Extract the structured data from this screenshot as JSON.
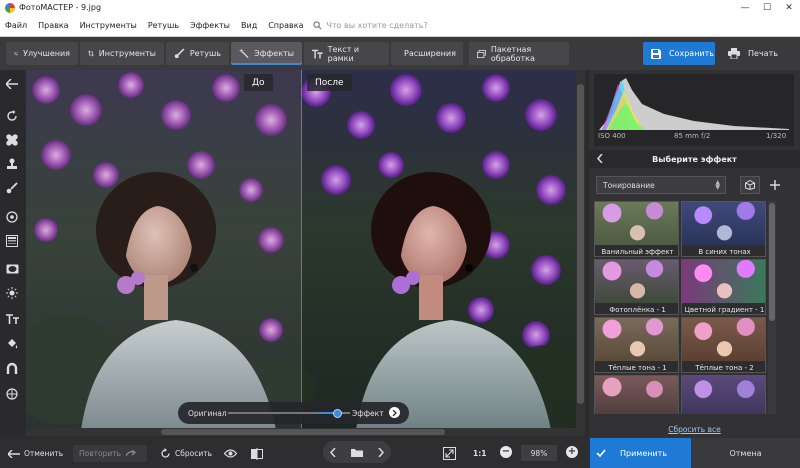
{
  "window": {
    "title": "ФотоМАСТЕР - 9.jpg"
  },
  "menu": {
    "items": [
      "Файл",
      "Правка",
      "Инструменты",
      "Ретушь",
      "Эффекты",
      "Вид",
      "Справка"
    ],
    "search_placeholder": "Что вы хотите сделать?"
  },
  "toolbar": {
    "tabs": [
      {
        "label": "Улучшения",
        "icon": "sliders-icon"
      },
      {
        "label": "Инструменты",
        "icon": "crop-icon"
      },
      {
        "label": "Ретушь",
        "icon": "brush-icon"
      },
      {
        "label": "Эффекты",
        "icon": "magic-wand-icon",
        "active": true
      },
      {
        "label": "Текст и рамки",
        "icon": "text-icon"
      },
      {
        "label": "Расширения",
        "icon": "plus-icon"
      }
    ],
    "batch_label": "Пакетная обработка",
    "save_label": "Сохранить",
    "print_label": "Печать"
  },
  "canvas": {
    "before_label": "До",
    "after_label": "После",
    "slider": {
      "left_label": "Оригинал",
      "right_label": "Эффект",
      "value_percent": 90
    }
  },
  "histogram": {
    "iso": "ISO 400",
    "lens": "85 mm f/2",
    "shutter": "1/320"
  },
  "effects_panel": {
    "title": "Выберите эффект",
    "category": "Тонирование",
    "effects": [
      {
        "label": "Ванильный эффект"
      },
      {
        "label": "В синих тонах"
      },
      {
        "label": "Фотоплёнка - 1"
      },
      {
        "label": "Цветной градиент - 1"
      },
      {
        "label": "Тёплые тона - 1"
      },
      {
        "label": "Тёплые тона - 2"
      },
      {
        "label": ""
      },
      {
        "label": ""
      }
    ],
    "reset_all": "Сбросить все"
  },
  "bottom": {
    "undo": "Отменить",
    "redo": "Повторить",
    "reset": "Сбросить",
    "ratio": "1:1",
    "zoom": "98%",
    "apply": "Применить",
    "cancel": "Отмена"
  },
  "colors": {
    "accent": "#1f7ad6",
    "panel": "#323235",
    "toolbar": "#3a3a3d"
  }
}
